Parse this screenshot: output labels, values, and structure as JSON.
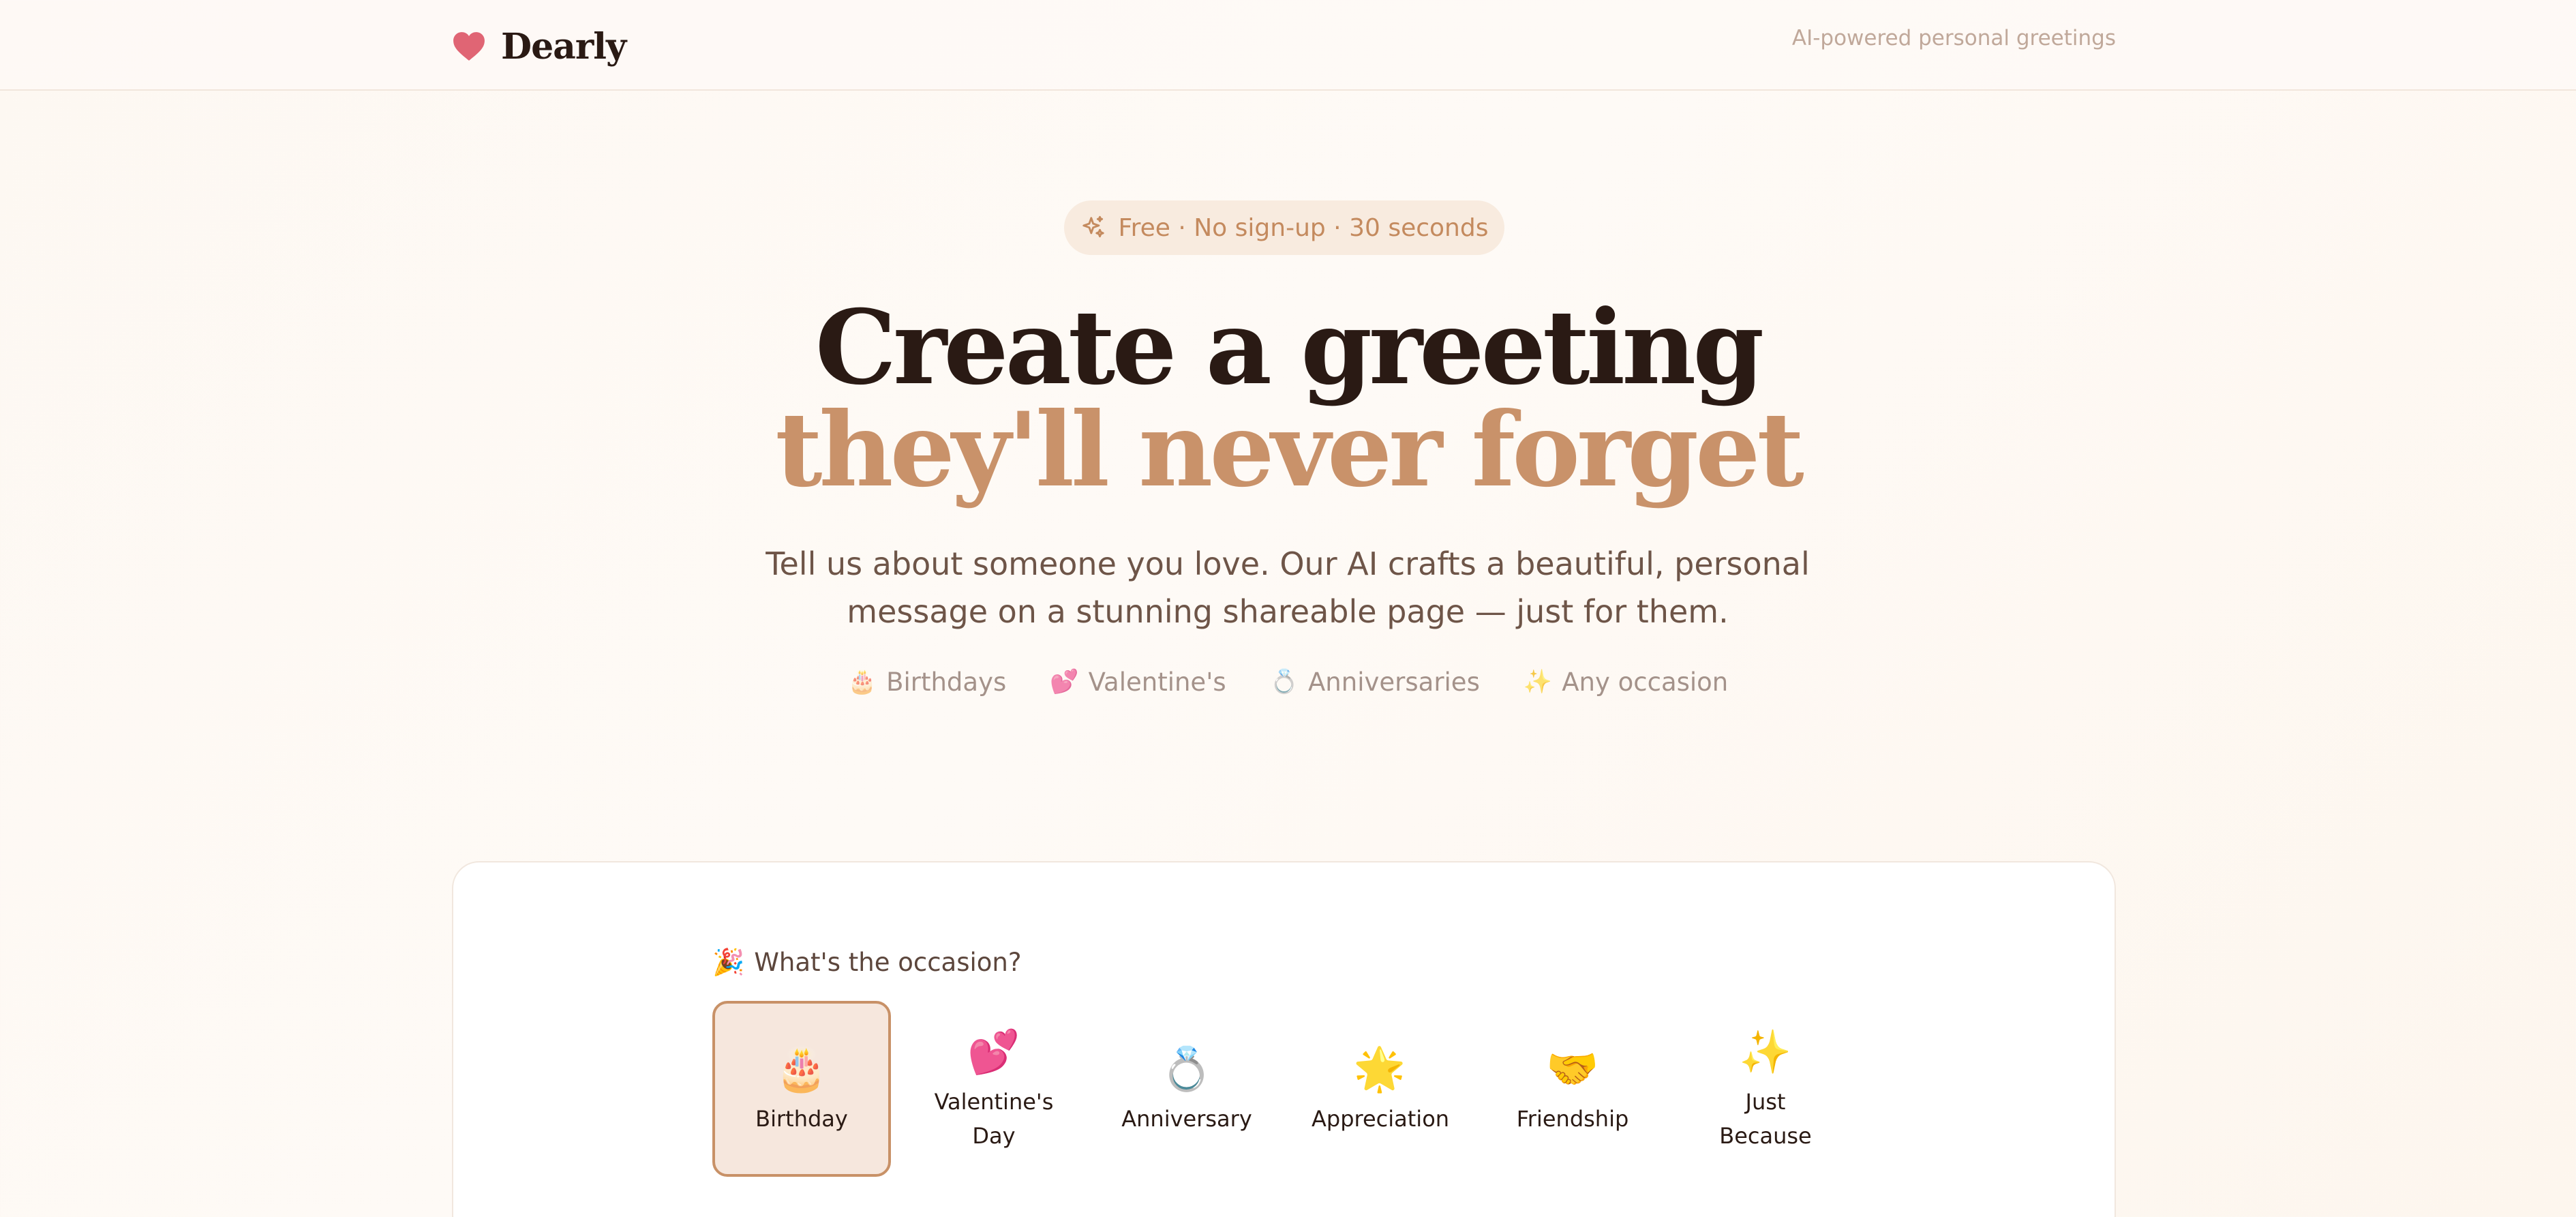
{
  "header": {
    "logo_text": "Dearly",
    "tagline": "AI-powered personal greetings"
  },
  "hero": {
    "pill_text": "Free · No sign-up · 30 seconds",
    "headline_line1": "Create a greeting",
    "headline_line2": "they'll never forget",
    "subtitle": "Tell us about someone you love. Our AI crafts a beautiful, personal message on a stunning shareable page — just for them.",
    "tags": [
      {
        "icon": "🎂",
        "label": "Birthdays"
      },
      {
        "icon": "💕",
        "label": "Valentine's"
      },
      {
        "icon": "💍",
        "label": "Anniversaries"
      },
      {
        "icon": "✨",
        "label": "Any occasion"
      }
    ]
  },
  "form": {
    "occasion_prompt_icon": "🎉",
    "occasion_prompt": "What's the occasion?",
    "occasions": [
      {
        "icon": "🎂",
        "label": "Birthday",
        "selected": true
      },
      {
        "icon": "💕",
        "label": "Valentine's Day",
        "selected": false
      },
      {
        "icon": "💍",
        "label": "Anniversary",
        "selected": false
      },
      {
        "icon": "🌟",
        "label": "Appreciation",
        "selected": false
      },
      {
        "icon": "🤝",
        "label": "Friendship",
        "selected": false
      },
      {
        "icon": "✨",
        "label": "Just Because",
        "selected": false
      }
    ]
  },
  "colors": {
    "accent": "#c9926a",
    "heart": "#e06574",
    "text_dark": "#2a1a14",
    "pill_bg": "#f8ebdf",
    "selected_bg": "#f6e7dd"
  }
}
